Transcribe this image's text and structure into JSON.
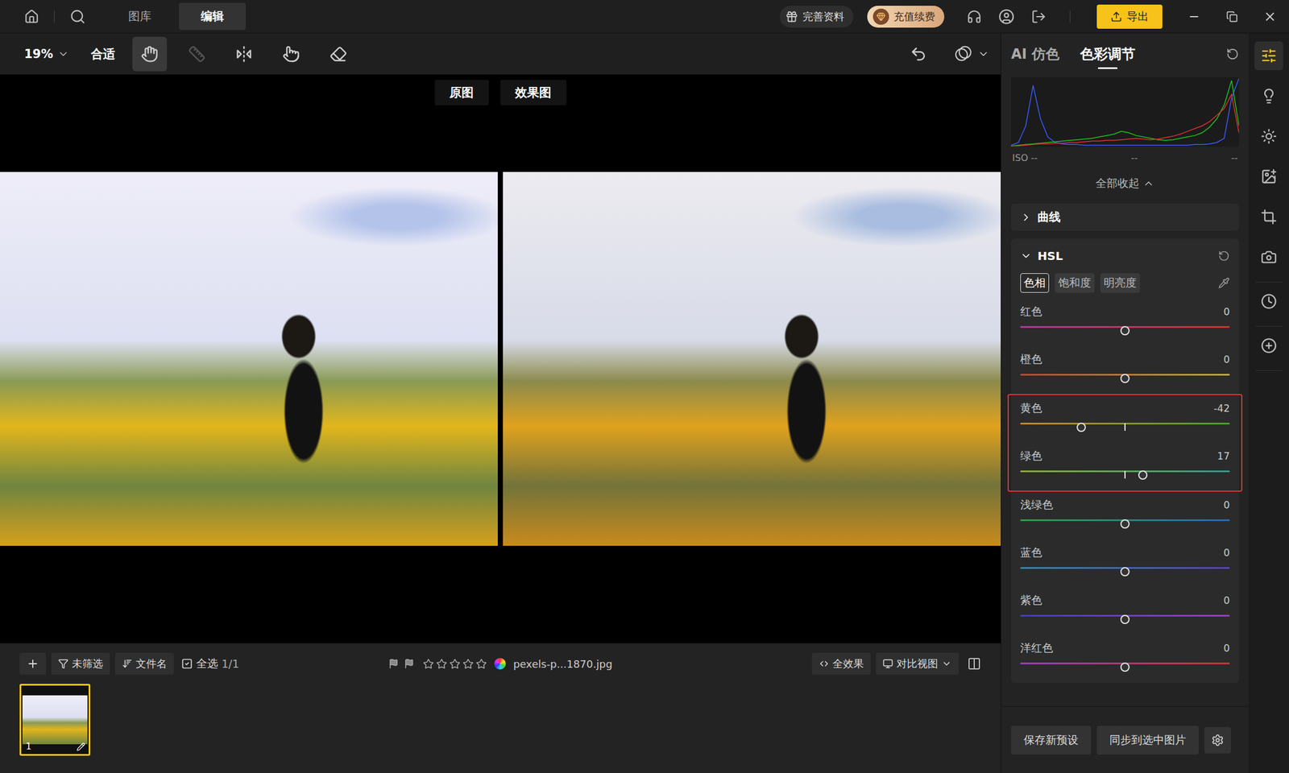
{
  "topbar": {
    "nav": [
      {
        "label": "图库",
        "selected": false
      },
      {
        "label": "编辑",
        "selected": true
      }
    ],
    "profile_button": "完善资料",
    "renew_button": "充值续费",
    "export_button": "导出"
  },
  "toolbar": {
    "zoom": "19%",
    "fit": "合适",
    "tools": [
      {
        "kind": "hand",
        "selected": true,
        "disabled": false
      },
      {
        "kind": "ruler",
        "selected": false,
        "disabled": true
      },
      {
        "kind": "flip",
        "selected": false,
        "disabled": false
      },
      {
        "kind": "touch",
        "selected": false,
        "disabled": false
      },
      {
        "kind": "heal",
        "selected": false,
        "disabled": false
      }
    ]
  },
  "canvas": {
    "views": [
      {
        "label": "原图",
        "kind": "before"
      },
      {
        "label": "效果图",
        "kind": "after"
      }
    ]
  },
  "filmstrip": {
    "filter": "未筛选",
    "sort": "文件名",
    "select_all": {
      "label": "全选",
      "checked": true
    },
    "count": "1/1",
    "flags": [
      {
        "kind": "pick",
        "on": false
      },
      {
        "kind": "reject",
        "on": false
      }
    ],
    "stars": 0,
    "filename": "pexels-p...1870.jpg",
    "effect_button": "全效果",
    "view_button": "对比视图",
    "thumbnails": [
      {
        "index": "1",
        "selected": true,
        "edited": true
      }
    ]
  },
  "panel": {
    "tabs": [
      {
        "label": "AI 仿色",
        "selected": false
      },
      {
        "label": "色彩调节",
        "selected": true
      }
    ],
    "histogram": {
      "series": [
        {
          "channel": "blue",
          "color": "#3b5bff",
          "values": [
            2,
            6,
            30,
            88,
            40,
            14,
            6,
            4,
            3,
            3,
            2,
            2,
            2,
            2,
            2,
            2,
            2,
            2,
            2,
            2,
            2,
            2,
            2,
            2,
            2,
            3,
            3,
            4,
            6,
            12,
            70,
            98
          ]
        },
        {
          "channel": "green",
          "color": "#1fc31f",
          "values": [
            1,
            2,
            3,
            4,
            5,
            6,
            7,
            8,
            9,
            10,
            11,
            12,
            14,
            16,
            18,
            22,
            20,
            16,
            14,
            12,
            10,
            9,
            10,
            12,
            14,
            16,
            20,
            28,
            40,
            60,
            95,
            30
          ]
        },
        {
          "channel": "red",
          "color": "#e0302e",
          "values": [
            1,
            1,
            2,
            3,
            4,
            4,
            5,
            5,
            6,
            6,
            7,
            8,
            8,
            9,
            9,
            10,
            11,
            12,
            11,
            10,
            11,
            13,
            15,
            18,
            22,
            26,
            30,
            36,
            45,
            55,
            75,
            20
          ]
        }
      ],
      "readings": [
        "ISO --",
        "--",
        "--"
      ]
    },
    "collapse_all": "全部收起",
    "sections": [
      {
        "title": "曲线",
        "expanded": false
      },
      {
        "title": "HSL",
        "expanded": true
      }
    ],
    "hsl": {
      "tabs": [
        {
          "label": "色相",
          "selected": true
        },
        {
          "label": "饱和度",
          "selected": false
        },
        {
          "label": "明亮度",
          "selected": false
        }
      ],
      "sliders": [
        {
          "label": "红色",
          "value": "0",
          "level": 0.5,
          "highlighted": false,
          "colors": [
            "#b03a9a",
            "#c8372e"
          ]
        },
        {
          "label": "橙色",
          "value": "0",
          "level": 0.5,
          "highlighted": false,
          "colors": [
            "#c2452c",
            "#b8b22a"
          ]
        },
        {
          "label": "黄色",
          "value": "-42",
          "level": 0.29,
          "highlighted": true,
          "colors": [
            "#c9892a",
            "#4aa02f"
          ]
        },
        {
          "label": "绿色",
          "value": "17",
          "level": 0.585,
          "highlighted": true,
          "colors": [
            "#8fae2a",
            "#2a9e8e"
          ]
        },
        {
          "label": "浅绿色",
          "value": "0",
          "level": 0.5,
          "highlighted": false,
          "colors": [
            "#2fa046",
            "#2a68b8"
          ]
        },
        {
          "label": "蓝色",
          "value": "0",
          "level": 0.5,
          "highlighted": false,
          "colors": [
            "#2a8cb0",
            "#5a3fc0"
          ]
        },
        {
          "label": "紫色",
          "value": "0",
          "level": 0.5,
          "highlighted": false,
          "colors": [
            "#3f3fc0",
            "#9a3fc0"
          ]
        },
        {
          "label": "洋红色",
          "value": "0",
          "level": 0.5,
          "highlighted": false,
          "colors": [
            "#9a3fc0",
            "#c8372e"
          ]
        }
      ]
    },
    "buttons": {
      "save_preset": "保存新预设",
      "sync": "同步到选中图片"
    }
  },
  "sidebar_icons": [
    [
      {
        "kind": "adjust",
        "selected": true
      },
      {
        "kind": "idea",
        "selected": false
      },
      {
        "kind": "light",
        "selected": false
      },
      {
        "kind": "image",
        "selected": false
      },
      {
        "kind": "crop",
        "selected": false
      },
      {
        "kind": "camera",
        "selected": false
      }
    ],
    [
      {
        "kind": "history",
        "selected": false
      }
    ],
    [
      {
        "kind": "add",
        "selected": false
      }
    ]
  ]
}
